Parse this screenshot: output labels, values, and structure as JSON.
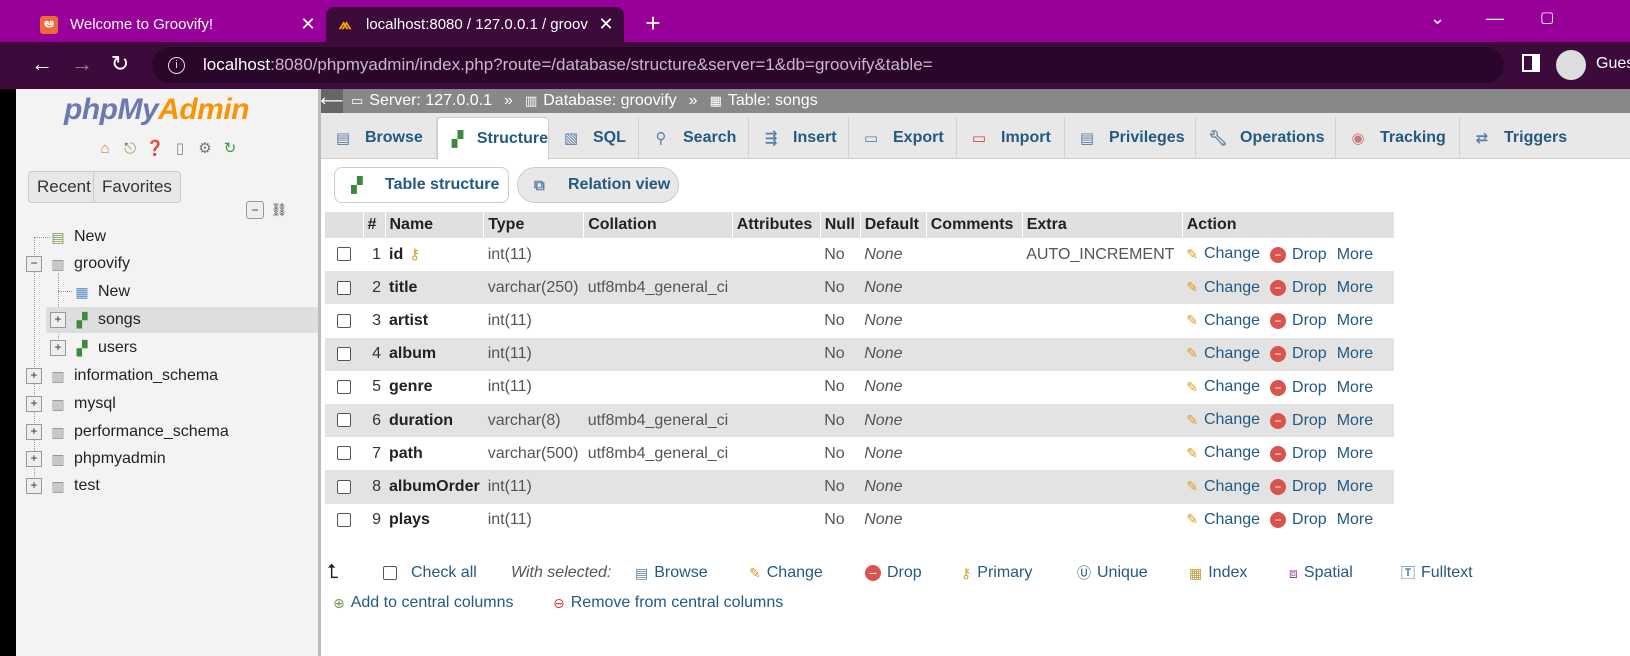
{
  "browser": {
    "tabs": [
      {
        "title": "Welcome to Groovify!",
        "favicon": "xampp-icon",
        "active": false
      },
      {
        "title": "localhost:8080 / 127.0.0.1 / groov",
        "favicon": "phpmyadmin-icon",
        "active": true
      }
    ],
    "url_host": "localhost",
    "url_path": ":8080/phpmyadmin/index.php?route=/database/structure&server=1&db=groovify&table=",
    "profile_label": "Guest",
    "theme_color": "#990099"
  },
  "nav": {
    "logo_php": "php",
    "logo_my": "My",
    "logo_admin": "Admin",
    "recent": "Recent",
    "favorites": "Favorites",
    "tree": {
      "new_top": "New",
      "groovify": "groovify",
      "new_db": "New",
      "songs": "songs",
      "users": "users",
      "information_schema": "information_schema",
      "mysql": "mysql",
      "performance_schema": "performance_schema",
      "phpmyadmin": "phpmyadmin",
      "test": "test"
    }
  },
  "breadcrumb": {
    "server": "Server: 127.0.0.1",
    "database": "Database: groovify",
    "table": "Table: songs",
    "sep": "»"
  },
  "menu_tabs": [
    "Browse",
    "Structure",
    "SQL",
    "Search",
    "Insert",
    "Export",
    "Import",
    "Privileges",
    "Operations",
    "Tracking",
    "Triggers"
  ],
  "subtabs": {
    "table_structure": "Table structure",
    "relation_view": "Relation view"
  },
  "table": {
    "headers": [
      "#",
      "Name",
      "Type",
      "Collation",
      "Attributes",
      "Null",
      "Default",
      "Comments",
      "Extra",
      "Action"
    ],
    "rows": [
      {
        "n": "1",
        "name": "id",
        "type": "int(11)",
        "collation": "",
        "null": "No",
        "default": "None",
        "extra": "AUTO_INCREMENT",
        "key": true
      },
      {
        "n": "2",
        "name": "title",
        "type": "varchar(250)",
        "collation": "utf8mb4_general_ci",
        "null": "No",
        "default": "None",
        "extra": ""
      },
      {
        "n": "3",
        "name": "artist",
        "type": "int(11)",
        "collation": "",
        "null": "No",
        "default": "None",
        "extra": ""
      },
      {
        "n": "4",
        "name": "album",
        "type": "int(11)",
        "collation": "",
        "null": "No",
        "default": "None",
        "extra": ""
      },
      {
        "n": "5",
        "name": "genre",
        "type": "int(11)",
        "collation": "",
        "null": "No",
        "default": "None",
        "extra": ""
      },
      {
        "n": "6",
        "name": "duration",
        "type": "varchar(8)",
        "collation": "utf8mb4_general_ci",
        "null": "No",
        "default": "None",
        "extra": ""
      },
      {
        "n": "7",
        "name": "path",
        "type": "varchar(500)",
        "collation": "utf8mb4_general_ci",
        "null": "No",
        "default": "None",
        "extra": ""
      },
      {
        "n": "8",
        "name": "albumOrder",
        "type": "int(11)",
        "collation": "",
        "null": "No",
        "default": "None",
        "extra": ""
      },
      {
        "n": "9",
        "name": "plays",
        "type": "int(11)",
        "collation": "",
        "null": "No",
        "default": "None",
        "extra": ""
      }
    ],
    "actions": {
      "change": "Change",
      "drop": "Drop",
      "more": "More"
    }
  },
  "bulk": {
    "check_all": "Check all",
    "with_selected": "With selected:",
    "browse": "Browse",
    "change": "Change",
    "drop": "Drop",
    "primary": "Primary",
    "unique": "Unique",
    "index": "Index",
    "spatial": "Spatial",
    "fulltext": "Fulltext",
    "add_central": "Add to central columns",
    "remove_central": "Remove from central columns"
  }
}
